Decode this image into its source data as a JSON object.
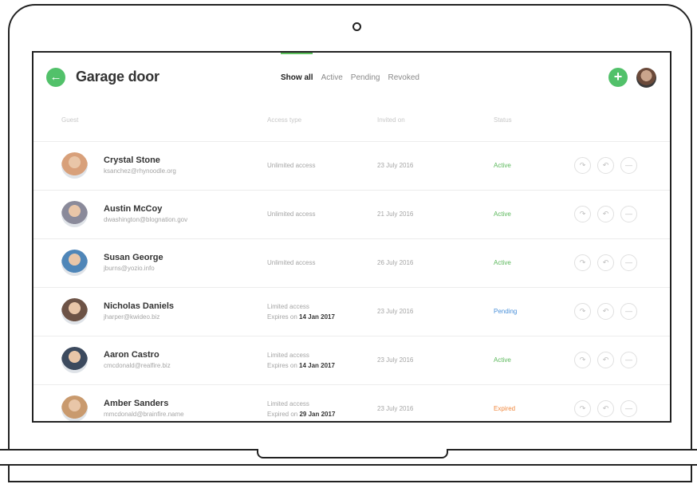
{
  "header": {
    "title": "Garage door",
    "filters": [
      "Show all",
      "Active",
      "Pending",
      "Revoked"
    ],
    "active_filter": "Show all",
    "accent_color": "#52c16a"
  },
  "columns": {
    "guest": "Guest",
    "access_type": "Access type",
    "invited_on": "Invited on",
    "status": "Status"
  },
  "icons": {
    "back": "arrow-left-icon",
    "add": "plus-icon",
    "row_actions": [
      "redo-icon",
      "undo-icon",
      "minus-icon"
    ]
  },
  "status_colors": {
    "Active": "#5cb85c",
    "Pending": "#4a90d9",
    "Expired": "#f0883e"
  },
  "guests": [
    {
      "name": "Crystal Stone",
      "email": "ksanchez@rhynoodle.org",
      "access_line1": "Unlimited access",
      "access_prefix": "",
      "access_date": "",
      "invited": "23 July 2016",
      "status": "Active",
      "avatar_color": "#d8a07a"
    },
    {
      "name": "Austin McCoy",
      "email": "dwashington@blognation.gov",
      "access_line1": "Unlimited access",
      "access_prefix": "",
      "access_date": "",
      "invited": "21 July 2016",
      "status": "Active",
      "avatar_color": "#8a8a9a"
    },
    {
      "name": "Susan George",
      "email": "jburns@yozio.info",
      "access_line1": "Unlimited access",
      "access_prefix": "",
      "access_date": "",
      "invited": "26 July 2016",
      "status": "Active",
      "avatar_color": "#4f86b8"
    },
    {
      "name": "Nicholas Daniels",
      "email": "jharper@kwideo.biz",
      "access_line1": "Limited access",
      "access_prefix": "Expires on ",
      "access_date": "14 Jan 2017",
      "invited": "23 July 2016",
      "status": "Pending",
      "avatar_color": "#6d5346"
    },
    {
      "name": "Aaron Castro",
      "email": "cmcdonald@realfire.biz",
      "access_line1": "Limited access",
      "access_prefix": "Expires on ",
      "access_date": "14 Jan 2017",
      "invited": "23 July 2016",
      "status": "Active",
      "avatar_color": "#3c4a5e"
    },
    {
      "name": "Amber Sanders",
      "email": "mmcdonald@brainfire.name",
      "access_line1": "Limited access",
      "access_prefix": "Expired on ",
      "access_date": "29 Jan 2017",
      "invited": "23 July 2016",
      "status": "Expired",
      "avatar_color": "#c99a6e"
    }
  ]
}
